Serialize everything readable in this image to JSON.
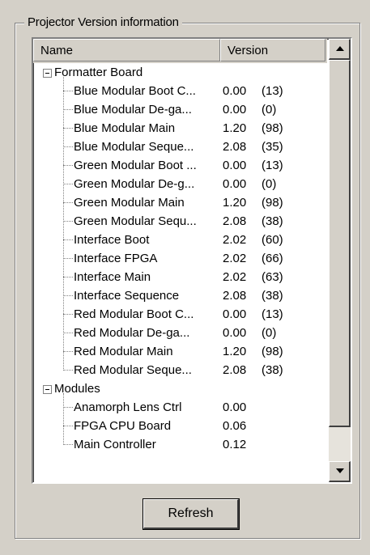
{
  "group": {
    "title": "Projector Version information"
  },
  "listview": {
    "columns": {
      "name": "Name",
      "version": "Version"
    },
    "groups": [
      {
        "label": "Formatter Board",
        "items": [
          {
            "name": "Blue Modular Boot C...",
            "version": "0.00",
            "count": "(13)"
          },
          {
            "name": "Blue Modular De-ga...",
            "version": "0.00",
            "count": "(0)"
          },
          {
            "name": "Blue Modular Main",
            "version": "1.20",
            "count": "(98)"
          },
          {
            "name": "Blue Modular Seque...",
            "version": "2.08",
            "count": "(35)"
          },
          {
            "name": "Green Modular Boot ...",
            "version": "0.00",
            "count": "(13)"
          },
          {
            "name": "Green Modular De-g...",
            "version": "0.00",
            "count": "(0)"
          },
          {
            "name": "Green Modular Main",
            "version": "1.20",
            "count": "(98)"
          },
          {
            "name": "Green Modular Sequ...",
            "version": "2.08",
            "count": "(38)"
          },
          {
            "name": "Interface Boot",
            "version": "2.02",
            "count": "(60)"
          },
          {
            "name": "Interface FPGA",
            "version": "2.02",
            "count": "(66)"
          },
          {
            "name": "Interface Main",
            "version": "2.02",
            "count": "(63)"
          },
          {
            "name": "Interface Sequence",
            "version": "2.08",
            "count": "(38)"
          },
          {
            "name": "Red Modular Boot C...",
            "version": "0.00",
            "count": "(13)"
          },
          {
            "name": "Red Modular De-ga...",
            "version": "0.00",
            "count": "(0)"
          },
          {
            "name": "Red Modular Main",
            "version": "1.20",
            "count": "(98)"
          },
          {
            "name": "Red Modular Seque...",
            "version": "2.08",
            "count": "(38)"
          }
        ]
      },
      {
        "label": "Modules",
        "items": [
          {
            "name": "Anamorph Lens Ctrl",
            "version": "0.00",
            "count": ""
          },
          {
            "name": "FPGA CPU Board",
            "version": "0.06",
            "count": ""
          },
          {
            "name": "Main Controller",
            "version": "0.12",
            "count": ""
          }
        ]
      }
    ]
  },
  "buttons": {
    "refresh": "Refresh"
  },
  "icons": {
    "scroll_up": "scroll-up-arrow-icon",
    "scroll_down": "scroll-down-arrow-icon",
    "collapse": "tree-collapse-icon"
  }
}
